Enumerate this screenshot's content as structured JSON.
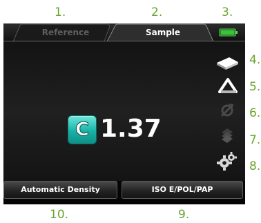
{
  "callouts": {
    "c1": "1.",
    "c2": "2.",
    "c3": "3.",
    "c4": "4.",
    "c5": "5.",
    "c6": "6.",
    "c7": "7.",
    "c8": "8.",
    "c9": "9.",
    "c10": "10."
  },
  "tabs": {
    "reference": "Reference",
    "sample": "Sample"
  },
  "measurement": {
    "channel": "C",
    "value": "1.37"
  },
  "battery_level": 1.0,
  "side_icons": [
    "paper-icon",
    "triangle-icon",
    "sync-disabled-icon",
    "stack-disabled-icon",
    "gears-icon"
  ],
  "bottom": {
    "mode": "Automatic Density",
    "standard": "ISO E/POL/PAP"
  },
  "colors": {
    "callout": "#6aa42e",
    "channel_badge": "#18b2a6",
    "battery": "#39c43a"
  }
}
